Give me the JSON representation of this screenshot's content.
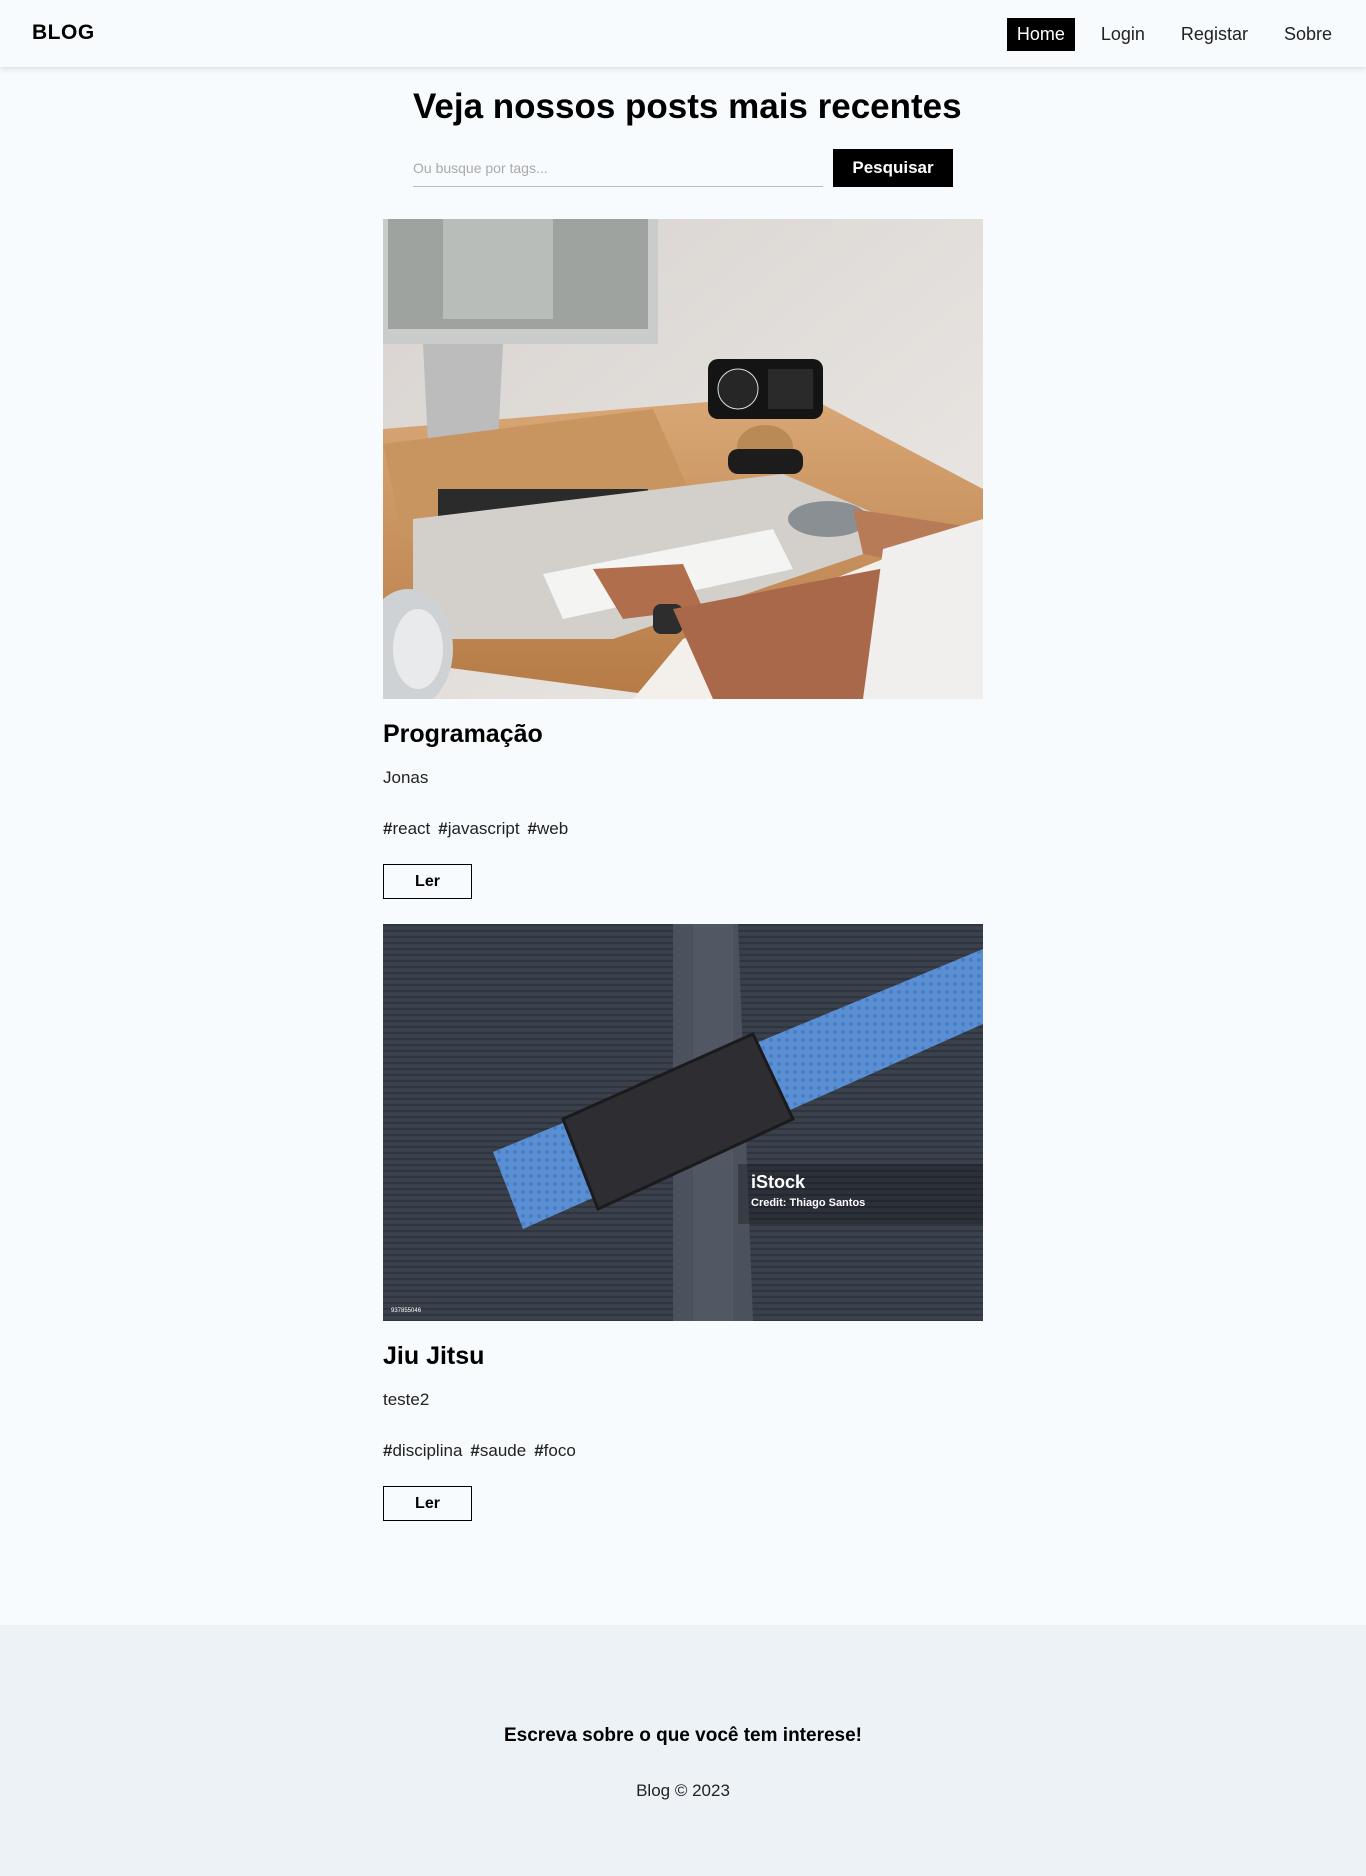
{
  "nav": {
    "brand": "BLOG",
    "links": [
      "Home",
      "Login",
      "Registar",
      "Sobre"
    ],
    "active": "Home"
  },
  "main": {
    "heading": "Veja nossos posts mais recentes",
    "search": {
      "placeholder": "Ou busque por tags...",
      "button_label": "Pesquisar"
    }
  },
  "posts": [
    {
      "image": "desk-workspace-photo",
      "title": "Programação",
      "author": "Jonas",
      "tags": [
        "react",
        "javascript",
        "web"
      ],
      "read_label": "Ler"
    },
    {
      "image": "jiu-jitsu-blue-belt-photo",
      "watermark": "iStock",
      "credit": "Credit: Thiago Santos",
      "stock_id": "937855046",
      "title": "Jiu Jitsu",
      "author": "teste2",
      "tags": [
        "disciplina",
        "saude",
        "foco"
      ],
      "read_label": "Ler"
    }
  ],
  "footer": {
    "tagline": "Escreva sobre o que você tem interese!",
    "copyright": "Blog © 2023"
  }
}
